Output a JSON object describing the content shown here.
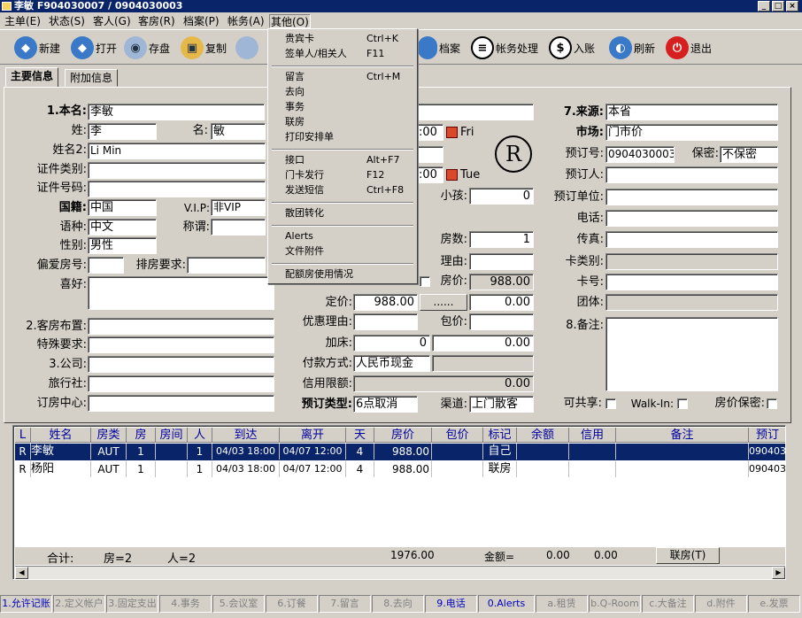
{
  "window": {
    "title": "李敏 F904030007 / 0904030003",
    "min": "_",
    "max": "□",
    "close": "×"
  },
  "menu": [
    "主单(E)",
    "状态(S)",
    "客人(G)",
    "客房(R)",
    "档案(P)",
    "帐务(A)",
    "其他(O)"
  ],
  "toolbar": [
    "新建",
    "打开",
    "存盘",
    "复制",
    "档案",
    "帐务处理",
    "入账",
    "刷新",
    "退出"
  ],
  "tabs": [
    "主要信息",
    "附加信息"
  ],
  "dropdown": {
    "groups": [
      [
        {
          "label": "贵宾卡",
          "shortcut": "Ctrl+K"
        },
        {
          "label": "签单人/相关人",
          "shortcut": "F11"
        }
      ],
      [
        {
          "label": "留言",
          "shortcut": "Ctrl+M"
        },
        {
          "label": "去向",
          "shortcut": ""
        },
        {
          "label": "事务",
          "shortcut": ""
        },
        {
          "label": "联房",
          "shortcut": ""
        },
        {
          "label": "打印安排单",
          "shortcut": ""
        }
      ],
      [
        {
          "label": "接口",
          "shortcut": "Alt+F7"
        },
        {
          "label": "门卡发行",
          "shortcut": "F12"
        },
        {
          "label": "发送短信",
          "shortcut": "Ctrl+F8"
        }
      ],
      [
        {
          "label": "散团转化",
          "shortcut": ""
        }
      ],
      [
        {
          "label": "Alerts",
          "shortcut": ""
        },
        {
          "label": "文件附件",
          "shortcut": ""
        }
      ],
      [
        {
          "label": "配额房使用情况",
          "shortcut": ""
        }
      ]
    ]
  },
  "left": {
    "l_name": "1.本名:",
    "name": "李敏",
    "l_surname": "姓:",
    "surname": "李",
    "l_given": "名:",
    "given": "敏",
    "l_name2": "姓名2:",
    "name2": "Li Min",
    "l_idtype": "证件类别:",
    "idtype": "",
    "l_idno": "证件号码:",
    "idno": "",
    "l_nation": "国籍:",
    "nation": "中国",
    "l_vip": "V.I.P:",
    "vip": "非VIP",
    "l_lang": "语种:",
    "lang": "中文",
    "l_title": "称谓:",
    "title": "",
    "l_sex": "性别:",
    "sex": "男性",
    "l_fav": "偏爱房号:",
    "fav": "",
    "l_req": "排房要求:",
    "req": "",
    "l_hobby": "喜好:",
    "hobby": "",
    "l_layout": "2.客房布置:",
    "layout": "",
    "l_special": "特殊要求:",
    "special": "",
    "l_company": "3.公司:",
    "company": "",
    "l_agency": "旅行社:",
    "agency": "",
    "l_center": "订房中心:",
    "center": ""
  },
  "mid": {
    "arr_date": ":00",
    "arr_day": "Fri",
    "dep_date": ":00",
    "dep_day": "Tue",
    "badge": "R",
    "l_child": "小孩:",
    "child": "0",
    "l_rooms": "房数:",
    "rooms": "1",
    "l_reason": "理由:",
    "reason": "",
    "l_roomprice": "房价:",
    "roomprice": "988.00",
    "l_fixed": "定价:",
    "fixed": "988.00",
    "dots": "......",
    "fixed2": "0.00",
    "l_discount": "优惠理由:",
    "discount": "",
    "l_pkg": "包价:",
    "pkg": "",
    "l_extra": "加床:",
    "extra": "0",
    "extra2": "0.00",
    "l_pay": "付款方式:",
    "pay": "人民币现金",
    "l_credit": "信用限额:",
    "credit": "0.00",
    "l_restype": "预订类型:",
    "restype": "6点取消",
    "l_channel": "渠道:",
    "channel": "上门散客"
  },
  "right": {
    "l_source": "7.来源:",
    "source": "本省",
    "l_market": "市场:",
    "market": "门市价",
    "l_resno": "预订号:",
    "resno": "0904030003",
    "l_secret": "保密:",
    "secret": "不保密",
    "l_booker": "预订人:",
    "booker": "",
    "l_unit": "预订单位:",
    "unit": "",
    "l_phone": "电话:",
    "phone": "",
    "l_fax": "传真:",
    "fax": "",
    "l_cardtype": "卡类别:",
    "cardtype": "",
    "l_cardno": "卡号:",
    "cardno": "",
    "l_group": "团体:",
    "group": "",
    "l_memo": "8.备注:",
    "memo": "",
    "l_share": "可共享:",
    "l_walkin": "Walk-In:",
    "l_pricesecret": "房价保密:"
  },
  "grid": {
    "headers": [
      "L",
      "姓名",
      "房类",
      "房",
      "房间",
      "人",
      "到达",
      "离开",
      "天",
      "房价",
      "包价",
      "标记",
      "余额",
      "信用",
      "备注",
      "预订"
    ],
    "rows": [
      [
        "R",
        "李敏",
        "AUT",
        "1",
        "",
        "1",
        "04/03 18:00",
        "04/07 12:00",
        "4",
        "988.00",
        "",
        "自己",
        "",
        "",
        "",
        "090403"
      ],
      [
        "R",
        "杨阳",
        "AUT",
        "1",
        "",
        "1",
        "04/03 18:00",
        "04/07 12:00",
        "4",
        "988.00",
        "",
        "联房",
        "",
        "",
        "",
        "090403"
      ]
    ],
    "footer": {
      "total": "合计:",
      "rooms": "房=2",
      "people": "人=2",
      "sum": "1976.00",
      "amount_label": "金额=",
      "amount1": "0.00",
      "amount2": "0.00",
      "link_button": "联房(T)"
    }
  },
  "status": [
    "1.允许记账",
    "2.定义帐户",
    "3.固定支出",
    "4.事务",
    "5.会议室",
    "6.订餐",
    "7.留言",
    "8.去向",
    "9.电话",
    "0.Alerts",
    "a.租赁",
    "b.Q-Room",
    "c.大备注",
    "d.附件",
    "e.发票"
  ]
}
